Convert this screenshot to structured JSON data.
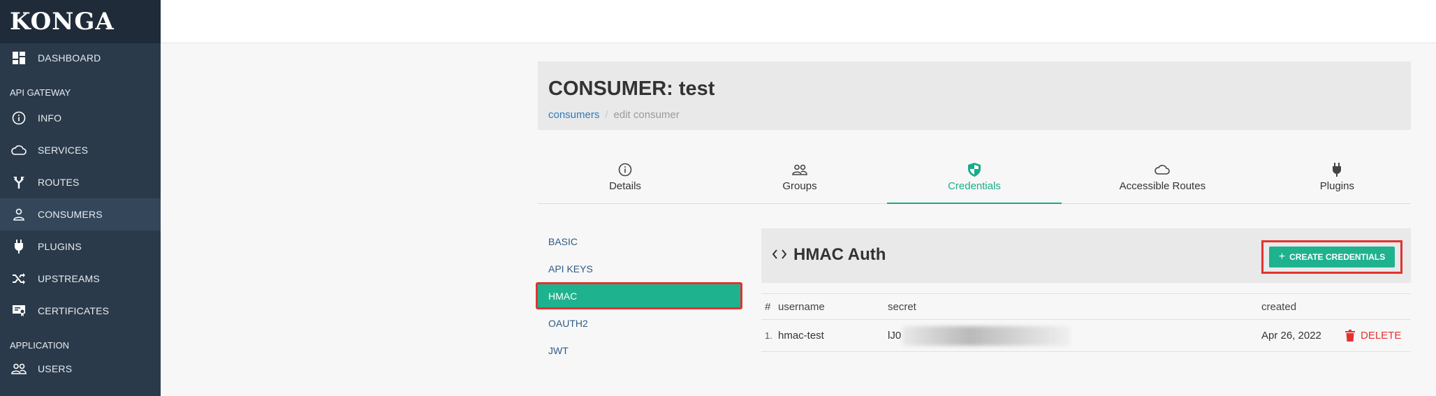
{
  "brand": {
    "name": "KONGA"
  },
  "sidebar": {
    "dashboard": "DASHBOARD",
    "section_gateway": "API GATEWAY",
    "items": [
      {
        "label": "INFO",
        "icon": "info-icon"
      },
      {
        "label": "SERVICES",
        "icon": "cloud-icon"
      },
      {
        "label": "ROUTES",
        "icon": "route-icon"
      },
      {
        "label": "CONSUMERS",
        "icon": "person-icon"
      },
      {
        "label": "PLUGINS",
        "icon": "plug-icon"
      },
      {
        "label": "UPSTREAMS",
        "icon": "shuffle-icon"
      },
      {
        "label": "CERTIFICATES",
        "icon": "certificate-icon"
      }
    ],
    "section_application": "APPLICATION",
    "users": "USERS"
  },
  "header": {
    "title": "CONSUMER: test",
    "breadcrumb_link": "consumers",
    "breadcrumb_sep": "/",
    "breadcrumb_current": "edit consumer"
  },
  "tabs": [
    {
      "label": "Details",
      "icon": "info-icon"
    },
    {
      "label": "Groups",
      "icon": "group-icon"
    },
    {
      "label": "Credentials",
      "icon": "shield-icon"
    },
    {
      "label": "Accessible Routes",
      "icon": "cloud-icon"
    },
    {
      "label": "Plugins",
      "icon": "plug-icon"
    }
  ],
  "credential_types": [
    "BASIC",
    "API KEYS",
    "HMAC",
    "OAUTH2",
    "JWT"
  ],
  "panel": {
    "title": "HMAC Auth",
    "create_label": "CREATE CREDENTIALS"
  },
  "table": {
    "headers": {
      "num": "#",
      "username": "username",
      "secret": "secret",
      "created": "created"
    },
    "rows": [
      {
        "num": "1.",
        "username": "hmac-test",
        "secret_visible": "lJ0",
        "created": "Apr 26, 2022",
        "action": "DELETE"
      }
    ]
  },
  "colors": {
    "accent": "#1fb28f",
    "sidebar": "#2b3a4a",
    "highlight": "#e53131",
    "link": "#2f7ab9"
  }
}
